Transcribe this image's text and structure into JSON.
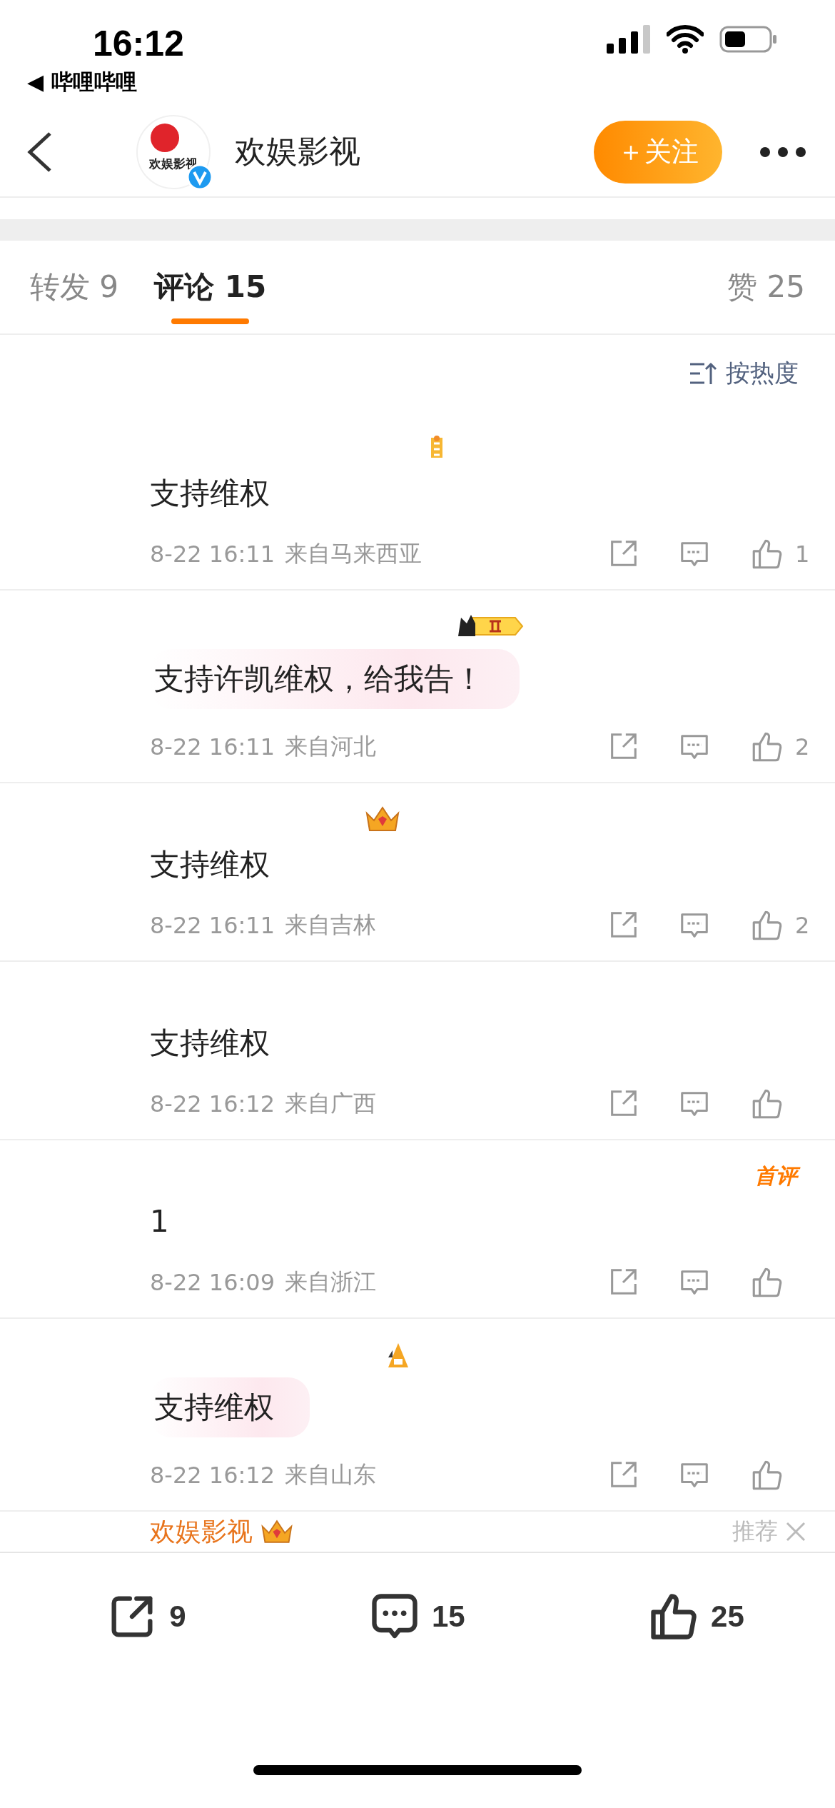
{
  "status_bar": {
    "time": "16:12",
    "back_app": "◀ 哔哩哔哩"
  },
  "header": {
    "avatar_text": "欢娱影视",
    "verified": true,
    "name": "欢娱影视",
    "follow": "＋关注"
  },
  "tabs": [
    {
      "label": "转发",
      "count": "9",
      "selected": false
    },
    {
      "label": "评论",
      "count": "15",
      "selected": true
    },
    {
      "label": "赞",
      "count": "25",
      "selected": false
    }
  ],
  "sort": "按热度",
  "comments": [
    {
      "badge": {
        "kind": "medal"
      },
      "text": "支持维权",
      "bubble": false,
      "time": "8-22 16:11",
      "location": "来自马来西亚",
      "likes": "1"
    },
    {
      "badge": {
        "kind": "level"
      },
      "text": "支持许凯维权，给我告！",
      "bubble": true,
      "time": "8-22 16:11",
      "location": "来自河北",
      "likes": "2"
    },
    {
      "badge": {
        "kind": "crown"
      },
      "text": "支持维权",
      "bubble": false,
      "time": "8-22 16:11",
      "location": "来自吉林",
      "likes": "2"
    },
    {
      "text": "支持维权",
      "bubble": false,
      "time": "8-22 16:12",
      "location": "来自广西"
    },
    {
      "badge": {
        "kind": "first",
        "text": "首评"
      },
      "text": "1",
      "bubble": false,
      "time": "8-22 16:09",
      "location": "来自浙江"
    },
    {
      "badge": {
        "kind": "fan"
      },
      "text": "支持维权",
      "bubble": true,
      "time": "8-22 16:12",
      "location": "来自山东"
    }
  ],
  "next_comment": {
    "name": "欢娱影视",
    "tag": "推荐"
  },
  "bottom_bar": {
    "reposts": "9",
    "comments": "15",
    "likes": "25"
  }
}
